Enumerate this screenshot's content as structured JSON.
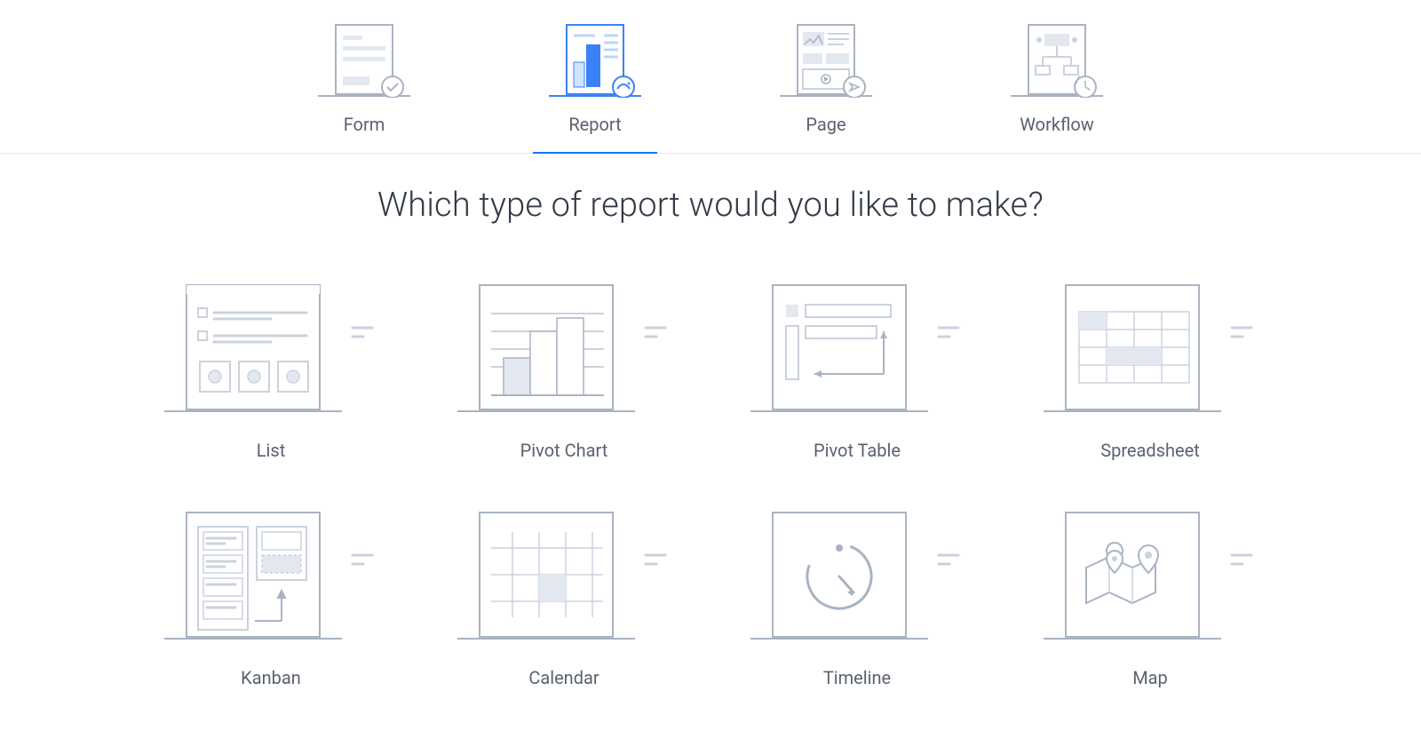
{
  "tabs": [
    {
      "label": "Form"
    },
    {
      "label": "Report"
    },
    {
      "label": "Page"
    },
    {
      "label": "Workflow"
    }
  ],
  "active_tab_index": 1,
  "heading": "Which type of report would you like to make?",
  "report_types": [
    {
      "label": "List"
    },
    {
      "label": "Pivot Chart"
    },
    {
      "label": "Pivot Table"
    },
    {
      "label": "Spreadsheet"
    },
    {
      "label": "Kanban"
    },
    {
      "label": "Calendar"
    },
    {
      "label": "Timeline"
    },
    {
      "label": "Map"
    }
  ]
}
